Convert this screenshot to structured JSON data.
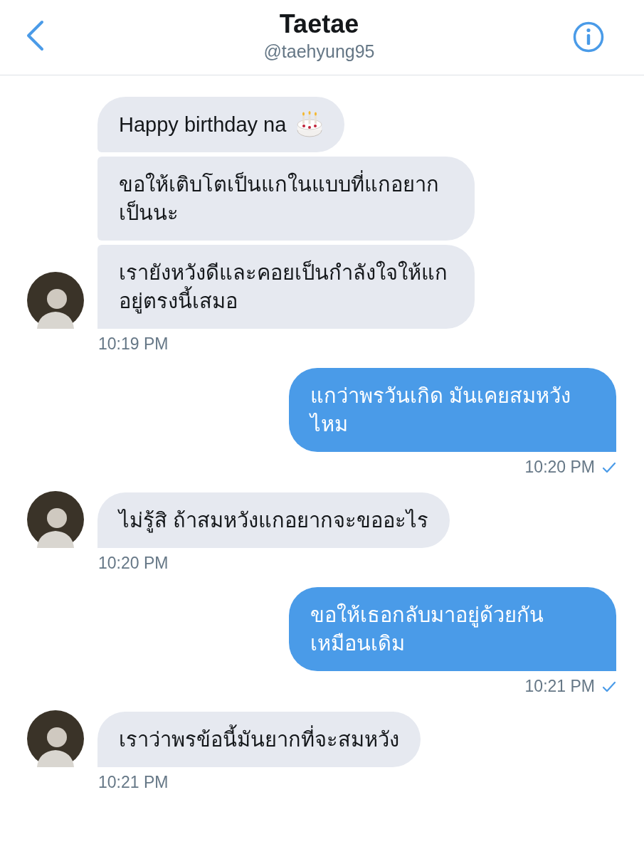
{
  "header": {
    "title": "Taetae",
    "handle": "@taehyung95"
  },
  "messages": [
    {
      "kind": "received",
      "bubbles": [
        {
          "text": "Happy birthday na",
          "cake": true
        },
        {
          "text": "ขอให้เติบโตเป็นแกในแบบที่แกอยากเป็นนะ",
          "cake": false
        },
        {
          "text": "เรายังหวังดีและคอยเป็นกำลังใจให้แกอยู่ตรงนี้เสมอ",
          "cake": false
        }
      ],
      "time": "10:19 PM",
      "seen": false
    },
    {
      "kind": "sent",
      "bubbles": [
        {
          "text": "แกว่าพรวันเกิด มันเคยสมหวังไหม",
          "cake": false
        }
      ],
      "time": "10:20 PM",
      "seen": true
    },
    {
      "kind": "received",
      "bubbles": [
        {
          "text": "ไม่รู้สิ ถ้าสมหวังแกอยากจะขออะไร",
          "cake": false
        }
      ],
      "time": "10:20 PM",
      "seen": false
    },
    {
      "kind": "sent",
      "bubbles": [
        {
          "text": "ขอให้เธอกลับมาอยู่ด้วยกันเหมือนเดิม",
          "cake": false
        }
      ],
      "time": "10:21 PM",
      "seen": true
    },
    {
      "kind": "received",
      "bubbles": [
        {
          "text": "เราว่าพรข้อนี้มันยากที่จะสมหวัง",
          "cake": false
        }
      ],
      "time": "10:21 PM",
      "seen": false
    }
  ]
}
